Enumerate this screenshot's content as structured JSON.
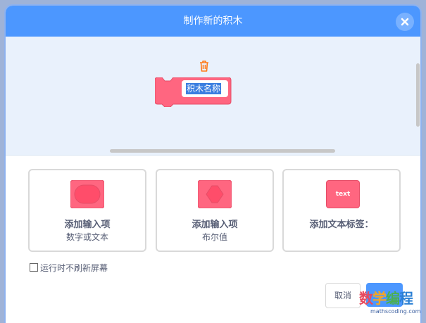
{
  "dialog": {
    "title": "制作新的积木",
    "close_icon": "close-icon"
  },
  "workspace": {
    "block_label": "积木名称",
    "trash_icon": "trash-icon"
  },
  "cards": [
    {
      "line1": "添加输入项",
      "line2": "数字或文本",
      "shape": "rounded-input-shape"
    },
    {
      "line1": "添加输入项",
      "line2": "布尔值",
      "shape": "boolean-input-shape"
    },
    {
      "line1": "添加文本标签：",
      "line2": "",
      "chip_text": "text"
    }
  ],
  "options": {
    "run_without_refresh": "运行时不刷新屏幕",
    "checked": false
  },
  "buttons": {
    "cancel": "取消",
    "ok": ""
  },
  "watermark": {
    "chars": [
      "数",
      "学",
      "编",
      "程"
    ],
    "site": "mathscoding.com"
  },
  "colors": {
    "header": "#4c97ff",
    "block": "#ff6680",
    "text": "#575e75"
  }
}
